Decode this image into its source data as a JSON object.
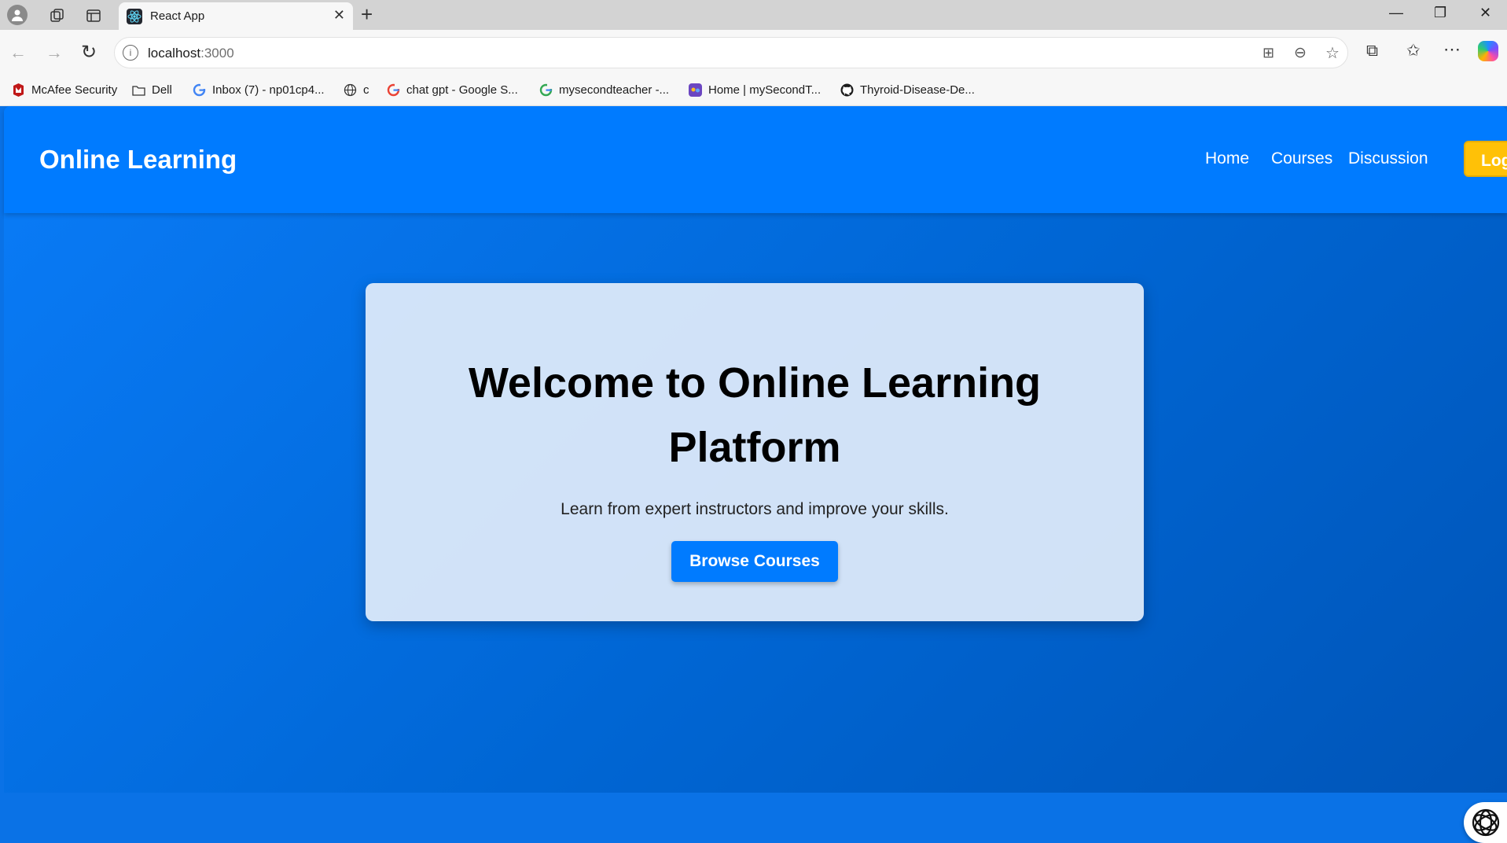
{
  "browser": {
    "tab_title": "React App",
    "url_host": "localhost",
    "url_port": ":3000",
    "bookmarks": [
      {
        "label": "McAfee Security",
        "icon": "mcafee-icon"
      },
      {
        "label": "Dell",
        "icon": "folder-icon"
      },
      {
        "label": "Inbox (7) - np01cp4...",
        "icon": "google-icon"
      },
      {
        "label": "c",
        "icon": "globe-icon"
      },
      {
        "label": "chat gpt - Google S...",
        "icon": "google-icon"
      },
      {
        "label": "mysecondteacher -...",
        "icon": "google-icon"
      },
      {
        "label": "Home | mySecondT...",
        "icon": "mst-icon"
      },
      {
        "label": "Thyroid-Disease-De...",
        "icon": "github-icon"
      }
    ]
  },
  "navbar": {
    "brand": "Online Learning",
    "links": [
      "Home",
      "Courses",
      "Discussion"
    ],
    "login_label": "Log"
  },
  "hero": {
    "title_line1": "Welcome to Online Learning",
    "title_line2": "Platform",
    "subtitle": "Learn from expert instructors and improve your skills.",
    "cta_label": "Browse Courses"
  },
  "colors": {
    "primary": "#007bff",
    "accent": "#ffc107",
    "hero_card": "#dce9f8"
  }
}
